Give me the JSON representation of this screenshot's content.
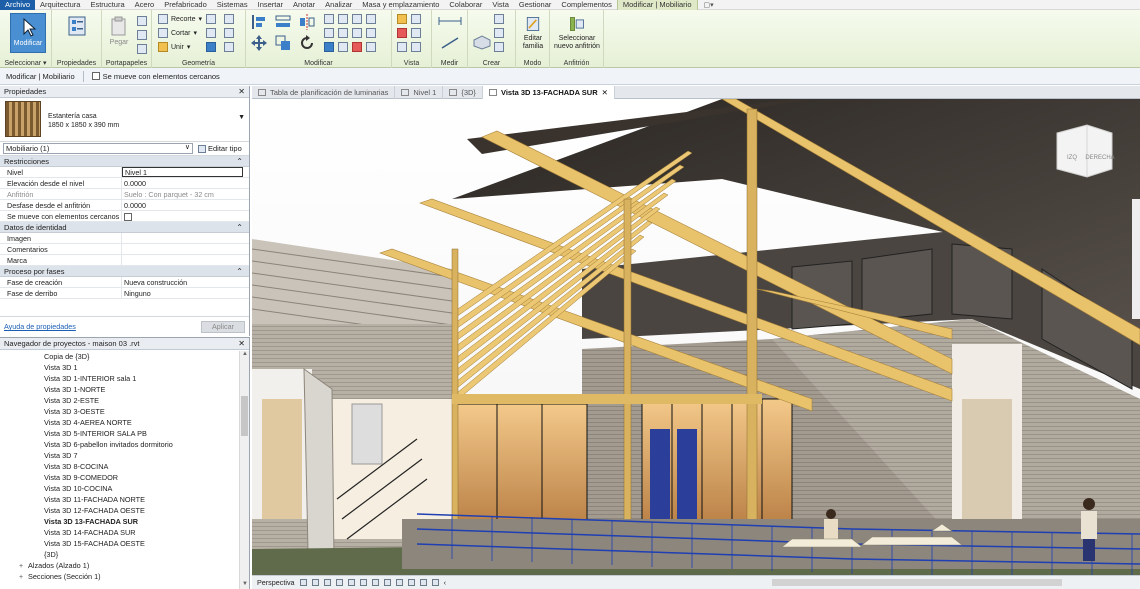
{
  "menu": {
    "tabs": [
      "Archivo",
      "Arquitectura",
      "Estructura",
      "Acero",
      "Prefabricado",
      "Sistemas",
      "Insertar",
      "Anotar",
      "Analizar",
      "Masa y emplazamiento",
      "Colaborar",
      "Vista",
      "Gestionar",
      "Complementos",
      "Modificar | Mobiliario"
    ],
    "extra": "▢▾"
  },
  "ribbon": {
    "modify": "Modificar",
    "select": "Seleccionar ▾",
    "properties": "Propiedades",
    "clipboard": "Portapapeles",
    "paste": "Pegar",
    "cope": "Recorte",
    "cut": "Cortar",
    "join": "Unir",
    "geometry": "Geometría",
    "modify_group": "Modificar",
    "view": "Vista",
    "measure": "Medir",
    "create": "Crear",
    "edit_family": "Editar familia",
    "mode": "Modo",
    "pick_host": "Seleccionar nuevo anfitrión",
    "host": "Anfitrión"
  },
  "context": {
    "label": "Modificar | Mobiliario",
    "moves_with_nearby": "Se mueve con elementos cercanos"
  },
  "properties": {
    "title": "Propiedades",
    "type_name": "Estantería casa",
    "type_size": "1850 x 1850 x 390 mm",
    "family_select": "Mobiliario (1)",
    "edit_type": "Editar tipo",
    "sections": {
      "constraints": "Restricciones",
      "identity": "Datos de identidad",
      "phasing": "Proceso por fases"
    },
    "rows_constraints": [
      {
        "k": "Nivel",
        "v": "Nivel 1"
      },
      {
        "k": "Elevación desde el nivel",
        "v": "0.0000"
      },
      {
        "k": "Anfitrión",
        "v": "Suelo : Con parquet - 32 cm"
      },
      {
        "k": "Desfase desde el anfitrión",
        "v": "0.0000"
      },
      {
        "k": "Se mueve con elementos cercanos",
        "v": ""
      }
    ],
    "rows_identity": [
      {
        "k": "Imagen",
        "v": ""
      },
      {
        "k": "Comentarios",
        "v": ""
      },
      {
        "k": "Marca",
        "v": ""
      }
    ],
    "rows_phasing": [
      {
        "k": "Fase de creación",
        "v": "Nueva construcción"
      },
      {
        "k": "Fase de derribo",
        "v": "Ninguno"
      }
    ],
    "help": "Ayuda de propiedades",
    "apply": "Aplicar"
  },
  "browser": {
    "title": "Navegador de proyectos - maison 03 .rvt",
    "items": [
      "Copia de {3D}",
      "Vista 3D 1",
      "Vista 3D 1-INTERIOR sala 1",
      "Vista 3D 1-NORTE",
      "Vista 3D 2-ESTE",
      "Vista 3D 3-OESTE",
      "Vista 3D 4-AEREA NORTE",
      "Vista 3D 5-INTERIOR SALA PB",
      "Vista 3D 6-pabellon invitados dormitorio",
      "Vista 3D 7",
      "Vista 3D 8-COCINA",
      "Vista 3D 9-COMEDOR",
      "Vista 3D 10-COCINA",
      "Vista 3D 11-FACHADA NORTE",
      "Vista 3D 12-FACHADA OESTE",
      "Vista 3D 13-FACHADA SUR",
      "Vista 3D 14-FACHADA SUR",
      "Vista 3D 15-FACHADA OESTE",
      "{3D}"
    ],
    "groups": [
      {
        "toggle": "+",
        "label": "Alzados (Alzado 1)"
      },
      {
        "toggle": "+",
        "label": "Secciones (Sección 1)"
      }
    ]
  },
  "views": {
    "tabs": [
      "Tabla de planificación de luminarias",
      "Nivel 1",
      "{3D}",
      "Vista 3D 13-FACHADA SUR"
    ],
    "viewcube_left": "IZQ",
    "viewcube_right": "DERECHA",
    "perspective": "Perspectiva"
  },
  "colors": {
    "accent": "#1c5fa8",
    "ribbon": "#e6f0d6",
    "railing": "#1f3fb3",
    "timber": "#e9c36c"
  }
}
